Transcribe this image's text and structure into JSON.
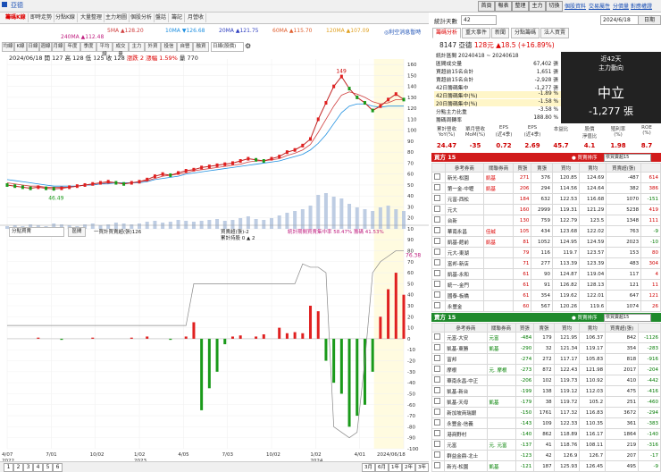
{
  "window": {
    "stock_name": "亞德",
    "buttons": [
      "首頁",
      "報表",
      "整理",
      "主力",
      "切換"
    ],
    "links": [
      "個股資料",
      "交易屬性",
      "分價量",
      "對應權證"
    ]
  },
  "left_tabs": [
    "籌碼K線",
    "即時走勢",
    "分點K線",
    "大量整理",
    "主力地圖",
    "個股分析",
    "盤話",
    "籌記",
    "月營收"
  ],
  "ma": {
    "items": [
      {
        "label": "5MA",
        "value": "▲128.20",
        "color": "#d04040"
      },
      {
        "label": "10MA",
        "value": "▼126.68",
        "color": "#2090e0"
      },
      {
        "label": "20MA",
        "value": "▲121.75",
        "color": "#3040c0"
      },
      {
        "label": "60MA",
        "value": "▲115.70",
        "color": "#e06030"
      },
      {
        "label": "120MA",
        "value": "▲107.09",
        "color": "#e0a020"
      },
      {
        "label": "240MA",
        "value": "▲112.48",
        "color": "#c02080"
      }
    ],
    "note": "◎利空消息暫時",
    "controls": [
      "均線",
      "K線",
      "日線",
      "週線",
      "月線",
      "年度",
      "季度",
      "平均線",
      "成交量",
      "主力",
      "外資",
      "投信",
      "自營",
      "融資"
    ],
    "period": "日線(股價)"
  },
  "price_info": {
    "date": "2024/06/18",
    "open": "開 127",
    "high": "高 128",
    "low": "低 125",
    "close": "收 128",
    "change": "漲跌 2",
    "pct": "漲幅 1.59%",
    "vol": "量 770"
  },
  "chart_labels": {
    "peak": "149",
    "low": "46.49",
    "sub_left": "分點買賣",
    "sub_btn": "區間",
    "buy_legend": "一買計買賣超(張)126",
    "sell_legend": "買賣超(張)-2",
    "close_legend": "累計持股 0 ▲ 2",
    "ratio_legend": "統計期間買賣集中率 58.47% 籌碼 41.53%",
    "sub_val": "76.38"
  },
  "chart_data": {
    "type": "line",
    "title": "",
    "xlabel": "",
    "ylabel": "",
    "x_ticks": [
      "4/07\n2022",
      "7/01",
      "10/02",
      "1/02\n2023",
      "4/05",
      "7/03",
      "10/02",
      "1/02\n2024",
      "4/01",
      "2024/06/18"
    ],
    "y_ticks_price": [
      "160",
      "150",
      "140",
      "130",
      "120",
      "110",
      "100",
      "90",
      "80",
      "70",
      "60",
      "50",
      "40",
      "30",
      "20",
      "10"
    ],
    "y_ticks_sub": [
      "90",
      "80",
      "70",
      "60",
      "50",
      "40",
      "30",
      "20",
      "10",
      "0",
      "-10",
      "-20",
      "-30",
      "-40",
      "-50",
      "-60",
      "-70",
      "-80",
      "-90",
      "-100"
    ],
    "ylim_price": [
      10,
      165
    ],
    "ylim_sub": [
      -100,
      95
    ],
    "price_series": [
      {
        "values": [
          50,
          49,
          48,
          47,
          48,
          47,
          46.49,
          47,
          48,
          49,
          50,
          51,
          52,
          53,
          52,
          51,
          52,
          53,
          55,
          58,
          60,
          59,
          61,
          63,
          64,
          66,
          67,
          68,
          69,
          70,
          72,
          74,
          73,
          72,
          74,
          76,
          80,
          82,
          86,
          92,
          110,
          125,
          140,
          149,
          138,
          130,
          125,
          118,
          122,
          128,
          133,
          128
        ]
      }
    ],
    "ma_series": [
      {
        "name": "",
        "values": [
          52,
          51,
          50,
          49,
          49,
          48,
          48,
          48,
          48,
          49,
          50,
          50,
          51,
          52,
          52,
          52,
          52,
          53,
          54,
          56,
          58,
          59,
          60,
          61,
          63,
          64,
          65,
          66,
          67,
          68,
          69,
          71,
          72,
          72,
          73,
          74,
          77,
          79,
          82,
          87,
          98,
          110,
          122,
          132,
          135,
          133,
          130,
          126,
          124,
          125,
          128,
          128
        ]
      },
      {
        "name": "",
        "values": [
          55,
          54,
          53,
          52,
          51,
          50,
          49,
          49,
          49,
          49,
          50,
          50,
          51,
          51,
          52,
          52,
          52,
          52,
          53,
          55,
          56,
          57,
          58,
          60,
          61,
          62,
          63,
          64,
          65,
          66,
          67,
          68,
          69,
          70,
          71,
          72,
          74,
          76,
          78,
          82,
          88,
          96,
          106,
          116,
          122,
          124,
          124,
          122,
          121,
          122,
          122,
          122
        ]
      }
    ],
    "volume": [
      3,
      4,
      3,
      5,
      4,
      3,
      6,
      5,
      4,
      3,
      5,
      6,
      4,
      5,
      7,
      6,
      5,
      6,
      8,
      9,
      7,
      8,
      10,
      9,
      8,
      9,
      10,
      11,
      9,
      10,
      12,
      14,
      11,
      10,
      12,
      15,
      18,
      20,
      22,
      26,
      38,
      40,
      36,
      34,
      28,
      24,
      22,
      20,
      24,
      26,
      22,
      20
    ],
    "sub_series": [
      {
        "values": [
          0,
          0,
          0,
          0,
          1,
          0,
          0,
          -1,
          0,
          0,
          0,
          1,
          0,
          0,
          0,
          0,
          1,
          0,
          2,
          0,
          0,
          -1,
          0,
          2,
          15,
          -65,
          -45,
          -30,
          -5,
          2,
          3,
          0,
          2,
          4,
          0,
          10,
          5,
          6,
          5,
          30,
          25,
          -20,
          -40,
          -50,
          -80,
          -70,
          -60,
          -30,
          20,
          45,
          60,
          40
        ]
      }
    ],
    "concentration": [
      {
        "values": [
          12,
          12,
          12,
          12,
          12,
          12,
          12,
          12,
          12,
          12,
          12,
          12,
          12,
          12,
          12,
          12,
          12,
          12,
          12,
          12,
          12,
          12,
          12,
          12,
          50,
          50,
          50,
          50,
          50,
          50,
          50,
          50,
          50,
          50,
          50,
          50,
          50,
          50,
          68,
          65,
          65,
          60,
          -80,
          -85,
          -90,
          -85,
          -20,
          60,
          70,
          75,
          80,
          80
        ]
      }
    ]
  },
  "right_panel": {
    "stat_period": "統計天數",
    "days": "42",
    "date": "2024/6/18",
    "day_btn": "日期",
    "tabs": [
      "籌碼分析",
      "重大事件",
      "新聞",
      "分點籌碼",
      "法人買賣"
    ],
    "code": "8147 亞德",
    "price": "128元",
    "change": "▲18.5 (+16.89%)",
    "stats": [
      {
        "label": "統計區間 20240418 ~ 20240618",
        "value": ""
      },
      {
        "label": "區間成交量",
        "value": "67,402 張"
      },
      {
        "label": "買超前15名合計",
        "value": "1,651 張"
      },
      {
        "label": "賣超前15名合計",
        "value": "-2,928 張"
      },
      {
        "label": "42日籌碼集中",
        "value": "-1,277 張"
      },
      {
        "label": "42日籌碼集中(%)",
        "value": "-1.89 %"
      },
      {
        "label": "20日籌碼集中(%)",
        "value": "-1.58 %"
      },
      {
        "label": "分點主力比重",
        "value": "-3.58 %"
      },
      {
        "label": "籌碼周轉率",
        "value": "188.80 %"
      }
    ],
    "big_title": "近42天",
    "big_sub": "主力動向",
    "big_word": "中立",
    "big_value": "-1,277 張",
    "metrics": [
      {
        "h": "累計營收\nYoY(%)",
        "v": "24.47"
      },
      {
        "h": "單月營收\nMoM(%)",
        "v": "-35"
      },
      {
        "h": "EPS\n(近4季)",
        "v": "0.72"
      },
      {
        "h": "EPS\n(近4季)",
        "v": "2.69"
      },
      {
        "h": "本益比",
        "v": "45.7"
      },
      {
        "h": "股價\n淨值比",
        "v": "4.1"
      },
      {
        "h": "殖利率\n(%)",
        "v": "1.98"
      },
      {
        "h": "ROE\n(%)",
        "v": "8.7"
      }
    ],
    "buy_title": "買方 15",
    "buy_select": "依買賣超15",
    "sort": "● 買賣排序",
    "sell_title": "賣方 15",
    "sell_select": "依買賣超15",
    "cols": [
      "參考券商",
      "關聯券商",
      "買張",
      "賣張",
      "買均",
      "賣均",
      "買賣超(張)"
    ],
    "buy_rows": [
      [
        "新光-松園",
        "凱基",
        "271",
        "376",
        "105",
        "120.85",
        "124.69",
        "-487",
        "614"
      ],
      [
        "第一金-中壢",
        "凱基",
        "206",
        "294",
        "88",
        "114.56",
        "124.64",
        "382",
        "386"
      ],
      [
        "元富-西松",
        "",
        "184",
        "632",
        "438",
        "122.53",
        "116.68",
        "1070",
        "-151"
      ],
      [
        "元大",
        "",
        "160",
        "2999",
        "2539",
        "119.31",
        "121.29",
        "5238",
        "419"
      ],
      [
        "台新",
        "",
        "130",
        "759",
        "609",
        "122.79",
        "123.5",
        "1348",
        "111"
      ],
      [
        "華南永昌",
        "佳誠",
        "105",
        "434",
        "329",
        "123.68",
        "122.02",
        "763",
        "-9"
      ],
      [
        "凱基-館前",
        "凱基",
        "81",
        "1052",
        "971",
        "124.95",
        "124.59",
        "2023",
        "-10"
      ],
      [
        "元大-東湖",
        "",
        "79",
        "116",
        "37",
        "119.7",
        "123.57",
        "153",
        "80"
      ],
      [
        "富邦-新店",
        "",
        "71",
        "277",
        "206",
        "113.39",
        "123.39",
        "483",
        "304"
      ],
      [
        "凱基-永和",
        "",
        "61",
        "90",
        "27",
        "124.87",
        "119.04",
        "117",
        "4"
      ],
      [
        "統一-金門",
        "",
        "61",
        "91",
        "30",
        "126.82",
        "128.13",
        "121",
        "11"
      ],
      [
        "國泰-板橋",
        "",
        "61",
        "354",
        "293",
        "119.62",
        "122.01",
        "647",
        "121"
      ],
      [
        "永豐金",
        "",
        "60",
        "567",
        "507",
        "120.26",
        "119.6",
        "1074",
        "26"
      ]
    ],
    "sell_rows": [
      [
        "元富-大安",
        "元富",
        "-484",
        "179",
        "663",
        "121.95",
        "106.37",
        "842",
        "-1126"
      ],
      [
        "凱基-東勝",
        "凱基",
        "-290",
        "32",
        "322",
        "121.34",
        "119.17",
        "354",
        "-283"
      ],
      [
        "富邦",
        "",
        "-274",
        "272",
        "546",
        "117.17",
        "105.83",
        "818",
        "-916"
      ],
      [
        "摩根",
        "元. 摩根",
        "-273",
        "872",
        "1145",
        "122.43",
        "121.98",
        "2017",
        "-204"
      ],
      [
        "華南永昌-中正",
        "",
        "-206",
        "102",
        "308",
        "119.73",
        "110.92",
        "410",
        "-442"
      ],
      [
        "凱基-新台",
        "",
        "-199",
        "138",
        "337",
        "119.12",
        "112.03",
        "475",
        "-416"
      ],
      [
        "凱基-天母",
        "凱基",
        "-179",
        "38",
        "215",
        "119.72",
        "105.2",
        "251",
        "-460"
      ],
      [
        "新加坡商瑞銀",
        "",
        "-150",
        "1761",
        "1911",
        "117.32",
        "116.83",
        "3672",
        "-294"
      ],
      [
        "永豐金-信義",
        "",
        "-143",
        "109",
        "252",
        "122.33",
        "110.35",
        "361",
        "-383"
      ],
      [
        "港商野村",
        "",
        "-140",
        "862",
        "1002",
        "118.89",
        "116.17",
        "1864",
        "-140"
      ],
      [
        "元富",
        "元. 元富",
        "-137",
        "41",
        "178",
        "118.76",
        "108.11",
        "219",
        "-316"
      ],
      [
        "群益金鼎-北士",
        "",
        "-123",
        "42",
        "165",
        "126.9",
        "126.7",
        "207",
        "-17"
      ],
      [
        "新光-松園",
        "凱基",
        "-121",
        "187",
        "308",
        "125.93",
        "126.45",
        "495",
        "-9"
      ]
    ]
  },
  "bottom": {
    "pages": [
      "1",
      "2",
      "3",
      "4",
      "5",
      "6"
    ],
    "ranges": [
      "3月",
      "6月",
      "1年",
      "2年",
      "3年"
    ]
  }
}
